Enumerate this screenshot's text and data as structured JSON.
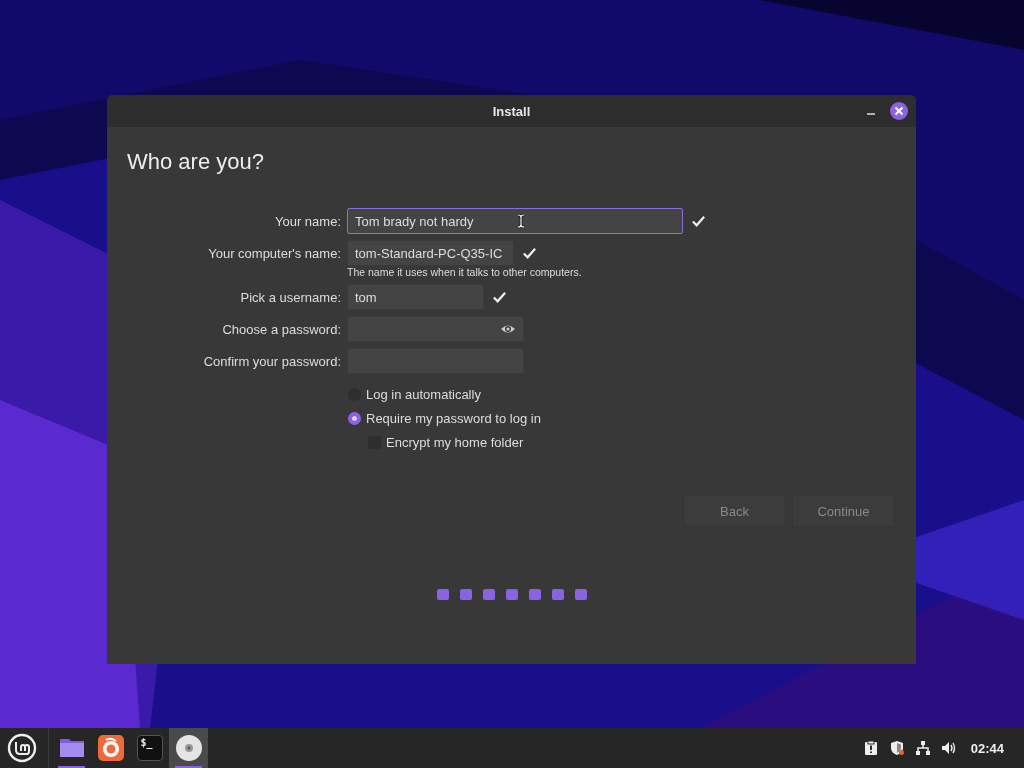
{
  "window": {
    "title": "Install"
  },
  "page": {
    "heading": "Who are you?"
  },
  "form": {
    "fields": [
      {
        "label": "Your name:",
        "value": "Tom brady not hardy",
        "focused": true,
        "valid": true
      },
      {
        "label": "Your computer's name:",
        "value": "tom-Standard-PC-Q35-IC",
        "focused": false,
        "valid": true,
        "hint": "The name it uses when it talks to other computers."
      },
      {
        "label": "Pick a username:",
        "value": "tom",
        "focused": false,
        "valid": true
      },
      {
        "label": "Choose a password:",
        "focused": false,
        "valid": false,
        "reveal": true
      },
      {
        "label": "Confirm your password:",
        "focused": false,
        "valid": false
      }
    ],
    "options": [
      {
        "kind": "radio",
        "label": "Log in automatically",
        "selected": false
      },
      {
        "kind": "radio",
        "label": "Require my password to log in",
        "selected": true
      },
      {
        "kind": "checkbox",
        "label": "Encrypt my home folder",
        "checked": false
      }
    ]
  },
  "buttons": [
    {
      "label": "Back",
      "disabled": true
    },
    {
      "label": "Continue",
      "disabled": true
    }
  ],
  "progress": [
    {
      "done": true
    },
    {
      "done": true
    },
    {
      "done": true
    },
    {
      "done": true
    },
    {
      "done": true
    },
    {
      "done": true
    },
    {
      "done": true
    }
  ],
  "taskbar": {
    "apps": [
      {
        "kind": "folder",
        "running": true,
        "selected": false
      },
      {
        "kind": "browser",
        "running": false,
        "selected": false
      },
      {
        "kind": "terminal",
        "text": "$_",
        "running": false,
        "selected": false
      },
      {
        "kind": "disc",
        "running": true,
        "selected": true
      }
    ],
    "clock": "02:44"
  }
}
